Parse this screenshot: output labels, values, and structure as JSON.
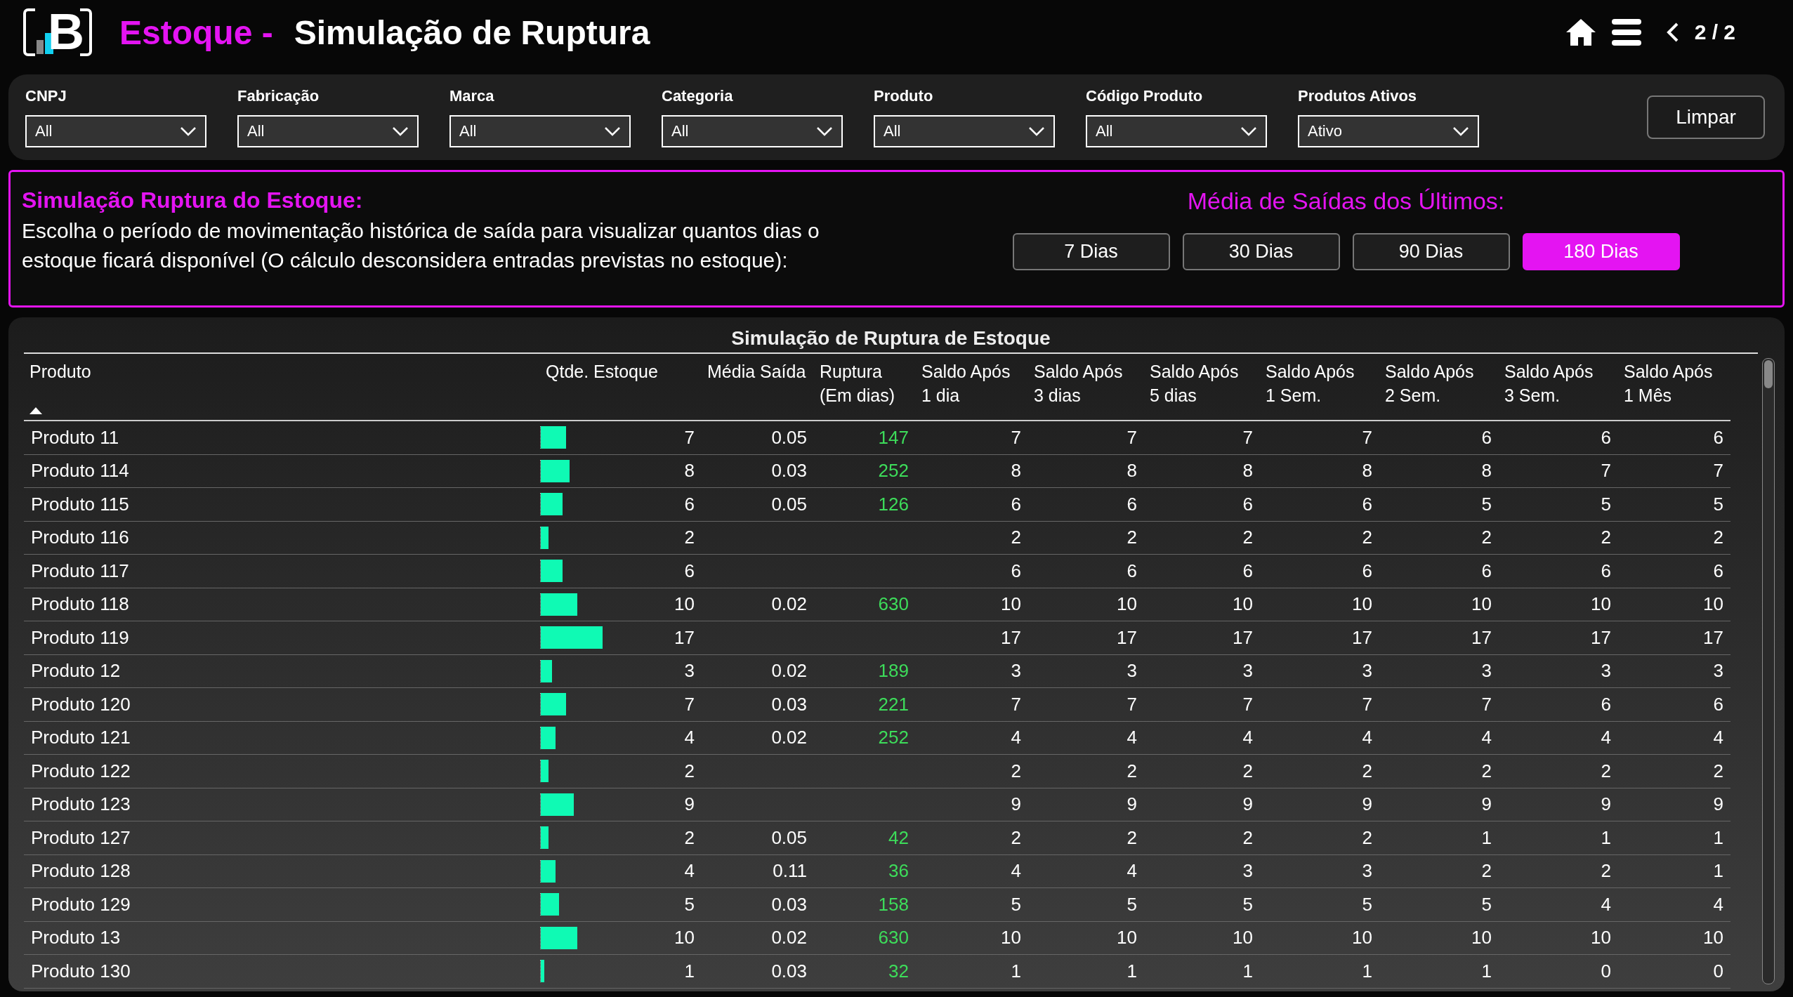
{
  "header": {
    "logo_letter": "B",
    "title_prefix": "Estoque -",
    "title": "Simulação de Ruptura",
    "page": "2 / 2"
  },
  "filters": [
    {
      "label": "CNPJ",
      "value": "All"
    },
    {
      "label": "Fabricação",
      "value": "All"
    },
    {
      "label": "Marca",
      "value": "All"
    },
    {
      "label": "Categoria",
      "value": "All"
    },
    {
      "label": "Produto",
      "value": "All"
    },
    {
      "label": "Código Produto",
      "value": "All"
    },
    {
      "label": "Produtos Ativos",
      "value": "Ativo"
    }
  ],
  "clear_button": "Limpar",
  "banner": {
    "heading": "Simulação Ruptura do Estoque:",
    "text": "Escolha o período de movimentação histórica de saída para visualizar quantos dias o estoque ficará disponível (O cálculo desconsidera entradas previstas no estoque):",
    "period_title": "Média de Saídas dos Últimos:",
    "periods": [
      {
        "label": "7 Dias",
        "selected": false
      },
      {
        "label": "30 Dias",
        "selected": false
      },
      {
        "label": "90 Dias",
        "selected": false
      },
      {
        "label": "180 Dias",
        "selected": true
      }
    ]
  },
  "table": {
    "title": "Simulação de Ruptura de Estoque",
    "columns": [
      {
        "label": "Produto",
        "sorted": true
      },
      {
        "label": "Qtde. Estoque",
        "sorted": false
      },
      {
        "label": "Média Saída",
        "sorted": false
      },
      {
        "label": "Ruptura\n(Em dias)",
        "sorted": false
      },
      {
        "label": "Saldo Após\n1 dia",
        "sorted": false
      },
      {
        "label": "Saldo Após\n3 dias",
        "sorted": false
      },
      {
        "label": "Saldo Após\n5 dias",
        "sorted": false
      },
      {
        "label": "Saldo Após\n1 Sem.",
        "sorted": false
      },
      {
        "label": "Saldo Após\n2 Sem.",
        "sorted": false
      },
      {
        "label": "Saldo Após\n3 Sem.",
        "sorted": false
      },
      {
        "label": "Saldo Após\n1 Mês",
        "sorted": false
      }
    ],
    "rows": [
      {
        "product": "Produto 11",
        "qty": "7",
        "level": 0.41,
        "media": "0.05",
        "ruptura": "147",
        "saldo": [
          "7",
          "7",
          "7",
          "7",
          "6",
          "6",
          "6"
        ]
      },
      {
        "product": "Produto 114",
        "qty": "8",
        "level": 0.47,
        "media": "0.03",
        "ruptura": "252",
        "saldo": [
          "8",
          "8",
          "8",
          "8",
          "8",
          "7",
          "7"
        ]
      },
      {
        "product": "Produto 115",
        "qty": "6",
        "level": 0.35,
        "media": "0.05",
        "ruptura": "126",
        "saldo": [
          "6",
          "6",
          "6",
          "6",
          "5",
          "5",
          "5"
        ]
      },
      {
        "product": "Produto 116",
        "qty": "2",
        "level": 0.12,
        "saldo": [
          "2",
          "2",
          "2",
          "2",
          "2",
          "2",
          "2"
        ]
      },
      {
        "product": "Produto 117",
        "qty": "6",
        "level": 0.35,
        "saldo": [
          "6",
          "6",
          "6",
          "6",
          "6",
          "6",
          "6"
        ]
      },
      {
        "product": "Produto 118",
        "qty": "10",
        "level": 0.59,
        "media": "0.02",
        "ruptura": "630",
        "saldo": [
          "10",
          "10",
          "10",
          "10",
          "10",
          "10",
          "10"
        ]
      },
      {
        "product": "Produto 119",
        "qty": "17",
        "level": 1,
        "saldo": [
          "17",
          "17",
          "17",
          "17",
          "17",
          "17",
          "17"
        ]
      },
      {
        "product": "Produto 12",
        "qty": "3",
        "level": 0.18,
        "media": "0.02",
        "ruptura": "189",
        "saldo": [
          "3",
          "3",
          "3",
          "3",
          "3",
          "3",
          "3"
        ]
      },
      {
        "product": "Produto 120",
        "qty": "7",
        "level": 0.41,
        "media": "0.03",
        "ruptura": "221",
        "saldo": [
          "7",
          "7",
          "7",
          "7",
          "7",
          "6",
          "6"
        ]
      },
      {
        "product": "Produto 121",
        "qty": "4",
        "level": 0.24,
        "media": "0.02",
        "ruptura": "252",
        "saldo": [
          "4",
          "4",
          "4",
          "4",
          "4",
          "4",
          "4"
        ]
      },
      {
        "product": "Produto 122",
        "qty": "2",
        "level": 0.12,
        "saldo": [
          "2",
          "2",
          "2",
          "2",
          "2",
          "2",
          "2"
        ]
      },
      {
        "product": "Produto 123",
        "qty": "9",
        "level": 0.53,
        "saldo": [
          "9",
          "9",
          "9",
          "9",
          "9",
          "9",
          "9"
        ]
      },
      {
        "product": "Produto 127",
        "qty": "2",
        "level": 0.12,
        "media": "0.05",
        "ruptura": "42",
        "saldo": [
          "2",
          "2",
          "2",
          "2",
          "1",
          "1",
          "1"
        ]
      },
      {
        "product": "Produto 128",
        "qty": "4",
        "level": 0.24,
        "media": "0.11",
        "ruptura": "36",
        "saldo": [
          "4",
          "4",
          "3",
          "3",
          "2",
          "2",
          "1"
        ]
      },
      {
        "product": "Produto 129",
        "qty": "5",
        "level": 0.29,
        "media": "0.03",
        "ruptura": "158",
        "saldo": [
          "5",
          "5",
          "5",
          "5",
          "5",
          "4",
          "4"
        ]
      },
      {
        "product": "Produto 13",
        "qty": "10",
        "level": 0.59,
        "media": "0.02",
        "ruptura": "630",
        "saldo": [
          "10",
          "10",
          "10",
          "10",
          "10",
          "10",
          "10"
        ]
      },
      {
        "product": "Produto 130",
        "qty": "1",
        "level": 0.06,
        "media": "0.03",
        "ruptura": "32",
        "saldo": [
          "1",
          "1",
          "1",
          "1",
          "1",
          "0",
          "0"
        ]
      }
    ]
  }
}
